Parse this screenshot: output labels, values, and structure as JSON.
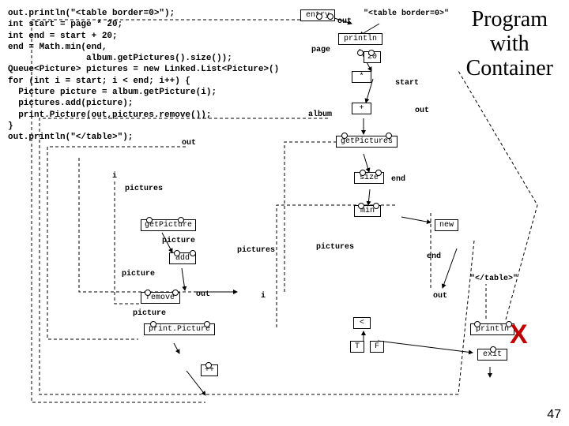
{
  "title_line1": "Program",
  "title_line2": "with",
  "title_line3": "Container",
  "code": "out.println(\"<table border=0>\");\nint start = page * 20;\nint end = start + 20;\nend = Math.min(end,\n               album.getPictures().size());\nQueue<Picture> pictures = new Linked.List<Picture>()\nfor (int i = start; i < end; i++) {\n  Picture picture = album.getPicture(i);\n  pictures.add(picture);\n  print.Picture(out,pictures.remove());\n}\nout.println(\"</table>\");",
  "slide_number": "47",
  "nodes": {
    "entry": "entry",
    "println1": "println",
    "literal1": "\"<table border=0>\"",
    "twenty": "20",
    "star": "*",
    "plus": "+",
    "getPictures": "getPictures",
    "size": "size",
    "min": "min",
    "getPicture": "getPicture",
    "add": "add",
    "remove": "remove",
    "printPicture": "print.Picture",
    "inc": "++",
    "lt": "<",
    "T": "T",
    "F": "F",
    "println2": "println",
    "exit": "exit",
    "new": "new",
    "literal2": "\"</table>\""
  },
  "labels": {
    "out": "out",
    "page": "page",
    "start": "start",
    "album": "album",
    "end": "end",
    "i": "i",
    "pictures": "pictures",
    "picture": "picture"
  },
  "red_x": "X"
}
